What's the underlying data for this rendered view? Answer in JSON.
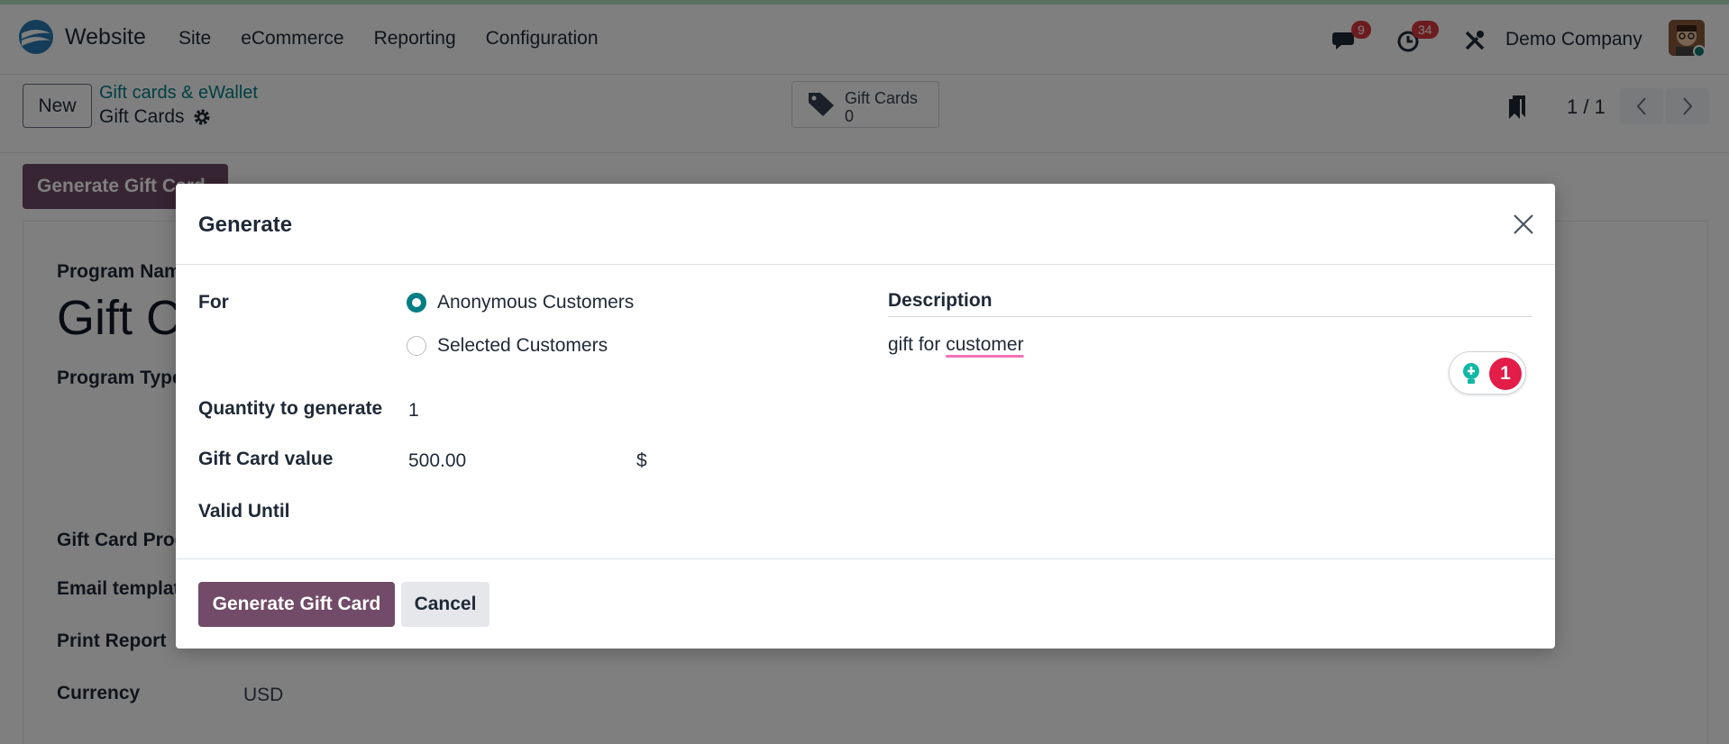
{
  "navbar": {
    "app_name": "Website",
    "menu": [
      "Site",
      "eCommerce",
      "Reporting",
      "Configuration"
    ],
    "messages_count": "9",
    "activities_count": "34",
    "company": "Demo Company"
  },
  "control": {
    "new_label": "New",
    "breadcrumb_parent": "Gift cards & eWallet",
    "breadcrumb_current": "Gift Cards",
    "smart_button_label": "Gift Cards",
    "smart_button_count": "0",
    "pager": "1 / 1"
  },
  "background_form": {
    "generate_button": "Generate Gift Card",
    "program_name_label": "Program Nam",
    "program_title": "Gift C",
    "program_type_label": "Program Type",
    "gift_card_product_label": "Gift Card Prod",
    "email_template_label": "Email templat",
    "print_report_label": "Print Report",
    "currency_label": "Currency",
    "currency_value": "USD"
  },
  "dialog": {
    "title": "Generate",
    "for_label": "For",
    "options": [
      "Anonymous Customers",
      "Selected Customers"
    ],
    "selected_option": "Anonymous Customers",
    "quantity_label": "Quantity to generate",
    "quantity_value": "1",
    "value_label": "Gift Card value",
    "value_amount": "500.00",
    "currency_symbol": "$",
    "valid_until_label": "Valid Until",
    "valid_until_value": "",
    "description_label": "Description",
    "description_prefix": "gift for ",
    "description_misspelled": "customer",
    "grammar_count": "1",
    "generate_button": "Generate Gift Card",
    "cancel_button": "Cancel"
  },
  "colors": {
    "primary": "#714b67",
    "accent": "#017e84",
    "badge": "#d9383e"
  }
}
